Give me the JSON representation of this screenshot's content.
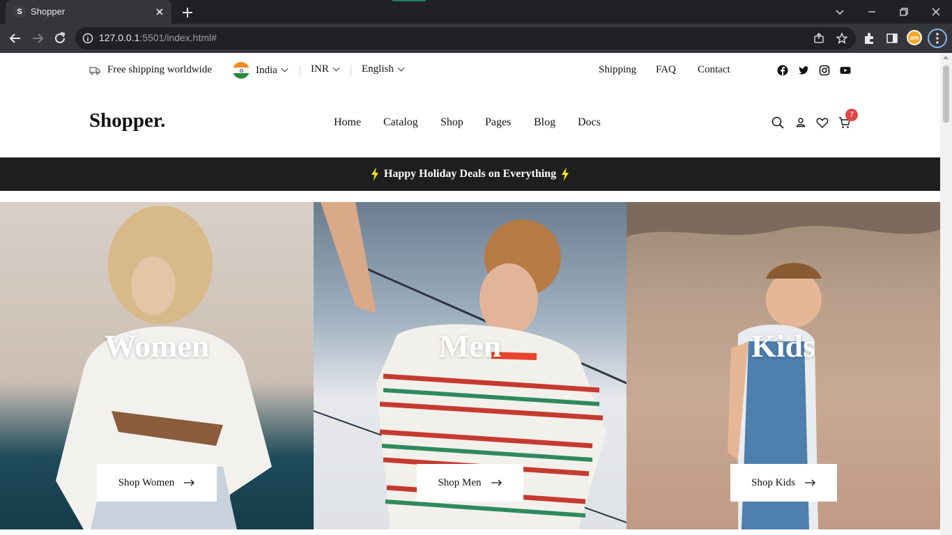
{
  "browser": {
    "tab_title": "Shopper",
    "tab_favicon": "S",
    "url_host": "127.0.0.1",
    "url_rest": ":5501/index.html#",
    "profile_label": "am"
  },
  "topbar": {
    "shipping_text": "Free shipping worldwide",
    "country": "India",
    "currency": "INR",
    "language": "English",
    "links": [
      "Shipping",
      "FAQ",
      "Contact"
    ],
    "social_icons": [
      "facebook-icon",
      "twitter-icon",
      "instagram-icon",
      "youtube-icon"
    ]
  },
  "header": {
    "logo": "Shopper.",
    "nav": [
      "Home",
      "Catalog",
      "Shop",
      "Pages",
      "Blog",
      "Docs"
    ],
    "cart_count": "7"
  },
  "promo": {
    "text": "Happy Holiday Deals on Everything"
  },
  "categories": [
    {
      "title": "Women",
      "button": "Shop Women"
    },
    {
      "title": "Men",
      "button": "Shop Men"
    },
    {
      "title": "Kids",
      "button": "Shop Kids"
    }
  ],
  "colors": {
    "promo_bg": "#1e1e1e",
    "bolt": "#f5e60a",
    "badge": "#e04848"
  }
}
